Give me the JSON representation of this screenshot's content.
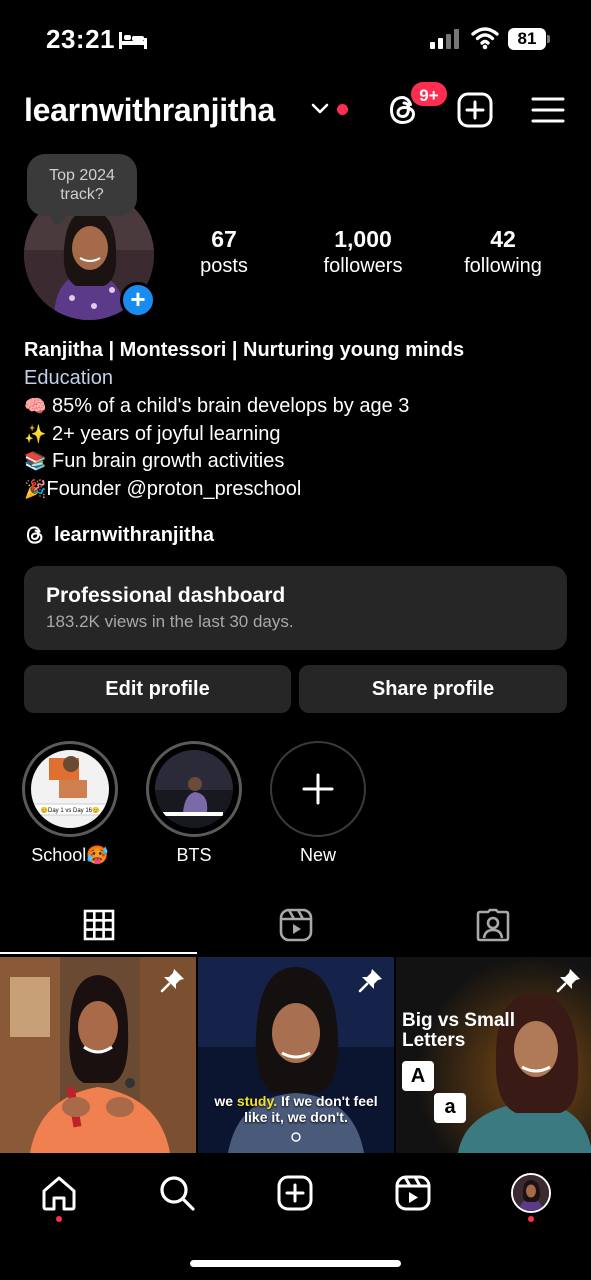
{
  "status_bar": {
    "time": "23:21",
    "battery": "81"
  },
  "header": {
    "username": "learnwithranjitha",
    "notification_badge": "9+"
  },
  "note": {
    "text": "Top 2024 track?"
  },
  "stats": [
    {
      "value": "67",
      "label": "posts"
    },
    {
      "value": "1,000",
      "label": "followers"
    },
    {
      "value": "42",
      "label": "following"
    }
  ],
  "bio": {
    "name": "Ranjitha | Montessori | Nurturing young minds",
    "category": "Education",
    "lines": [
      {
        "emoji": "🧠",
        "text": "85% of a child's brain develops by age 3"
      },
      {
        "emoji": "✨",
        "text": "2+ years of joyful learning"
      },
      {
        "emoji": "📚",
        "text": "Fun brain growth activities"
      },
      {
        "emoji": "🎉",
        "text": "Founder @proton_preschool"
      }
    ],
    "threads_handle": "learnwithranjitha"
  },
  "dashboard": {
    "title": "Professional dashboard",
    "subtitle": "183.2K views in the last 30 days."
  },
  "buttons": {
    "edit": "Edit profile",
    "share": "Share profile"
  },
  "highlights": [
    {
      "label": "School🥵"
    },
    {
      "label": "BTS"
    },
    {
      "label": "New"
    }
  ],
  "posts": [
    {
      "caption": ""
    },
    {
      "caption_pre": "we ",
      "caption_hl": "study.",
      "caption_post": " If we don't feel like it, we don't."
    },
    {
      "title": "Big vs Small Letters",
      "tile_a": "A",
      "tile_b": "a"
    }
  ],
  "highlight_cover_text": "😊Day 1 vs Day 16😊",
  "colors": {
    "accent": "#ff2e50",
    "blue": "#1a8cf0",
    "card": "#262626"
  }
}
